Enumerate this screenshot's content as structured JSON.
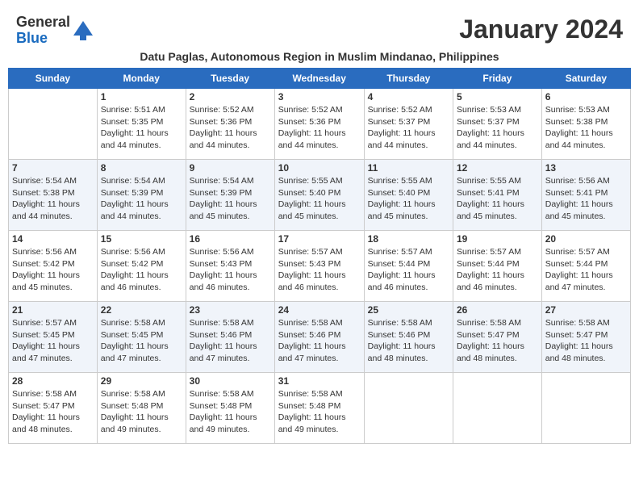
{
  "logo": {
    "text_general": "General",
    "text_blue": "Blue"
  },
  "header": {
    "month_year": "January 2024",
    "location": "Datu Paglas, Autonomous Region in Muslim Mindanao, Philippines"
  },
  "columns": [
    "Sunday",
    "Monday",
    "Tuesday",
    "Wednesday",
    "Thursday",
    "Friday",
    "Saturday"
  ],
  "weeks": [
    {
      "days": [
        {
          "number": "",
          "detail": ""
        },
        {
          "number": "1",
          "detail": "Sunrise: 5:51 AM\nSunset: 5:35 PM\nDaylight: 11 hours\nand 44 minutes."
        },
        {
          "number": "2",
          "detail": "Sunrise: 5:52 AM\nSunset: 5:36 PM\nDaylight: 11 hours\nand 44 minutes."
        },
        {
          "number": "3",
          "detail": "Sunrise: 5:52 AM\nSunset: 5:36 PM\nDaylight: 11 hours\nand 44 minutes."
        },
        {
          "number": "4",
          "detail": "Sunrise: 5:52 AM\nSunset: 5:37 PM\nDaylight: 11 hours\nand 44 minutes."
        },
        {
          "number": "5",
          "detail": "Sunrise: 5:53 AM\nSunset: 5:37 PM\nDaylight: 11 hours\nand 44 minutes."
        },
        {
          "number": "6",
          "detail": "Sunrise: 5:53 AM\nSunset: 5:38 PM\nDaylight: 11 hours\nand 44 minutes."
        }
      ]
    },
    {
      "days": [
        {
          "number": "7",
          "detail": "Sunrise: 5:54 AM\nSunset: 5:38 PM\nDaylight: 11 hours\nand 44 minutes."
        },
        {
          "number": "8",
          "detail": "Sunrise: 5:54 AM\nSunset: 5:39 PM\nDaylight: 11 hours\nand 44 minutes."
        },
        {
          "number": "9",
          "detail": "Sunrise: 5:54 AM\nSunset: 5:39 PM\nDaylight: 11 hours\nand 45 minutes."
        },
        {
          "number": "10",
          "detail": "Sunrise: 5:55 AM\nSunset: 5:40 PM\nDaylight: 11 hours\nand 45 minutes."
        },
        {
          "number": "11",
          "detail": "Sunrise: 5:55 AM\nSunset: 5:40 PM\nDaylight: 11 hours\nand 45 minutes."
        },
        {
          "number": "12",
          "detail": "Sunrise: 5:55 AM\nSunset: 5:41 PM\nDaylight: 11 hours\nand 45 minutes."
        },
        {
          "number": "13",
          "detail": "Sunrise: 5:56 AM\nSunset: 5:41 PM\nDaylight: 11 hours\nand 45 minutes."
        }
      ]
    },
    {
      "days": [
        {
          "number": "14",
          "detail": "Sunrise: 5:56 AM\nSunset: 5:42 PM\nDaylight: 11 hours\nand 45 minutes."
        },
        {
          "number": "15",
          "detail": "Sunrise: 5:56 AM\nSunset: 5:42 PM\nDaylight: 11 hours\nand 46 minutes."
        },
        {
          "number": "16",
          "detail": "Sunrise: 5:56 AM\nSunset: 5:43 PM\nDaylight: 11 hours\nand 46 minutes."
        },
        {
          "number": "17",
          "detail": "Sunrise: 5:57 AM\nSunset: 5:43 PM\nDaylight: 11 hours\nand 46 minutes."
        },
        {
          "number": "18",
          "detail": "Sunrise: 5:57 AM\nSunset: 5:44 PM\nDaylight: 11 hours\nand 46 minutes."
        },
        {
          "number": "19",
          "detail": "Sunrise: 5:57 AM\nSunset: 5:44 PM\nDaylight: 11 hours\nand 46 minutes."
        },
        {
          "number": "20",
          "detail": "Sunrise: 5:57 AM\nSunset: 5:44 PM\nDaylight: 11 hours\nand 47 minutes."
        }
      ]
    },
    {
      "days": [
        {
          "number": "21",
          "detail": "Sunrise: 5:57 AM\nSunset: 5:45 PM\nDaylight: 11 hours\nand 47 minutes."
        },
        {
          "number": "22",
          "detail": "Sunrise: 5:58 AM\nSunset: 5:45 PM\nDaylight: 11 hours\nand 47 minutes."
        },
        {
          "number": "23",
          "detail": "Sunrise: 5:58 AM\nSunset: 5:46 PM\nDaylight: 11 hours\nand 47 minutes."
        },
        {
          "number": "24",
          "detail": "Sunrise: 5:58 AM\nSunset: 5:46 PM\nDaylight: 11 hours\nand 47 minutes."
        },
        {
          "number": "25",
          "detail": "Sunrise: 5:58 AM\nSunset: 5:46 PM\nDaylight: 11 hours\nand 48 minutes."
        },
        {
          "number": "26",
          "detail": "Sunrise: 5:58 AM\nSunset: 5:47 PM\nDaylight: 11 hours\nand 48 minutes."
        },
        {
          "number": "27",
          "detail": "Sunrise: 5:58 AM\nSunset: 5:47 PM\nDaylight: 11 hours\nand 48 minutes."
        }
      ]
    },
    {
      "days": [
        {
          "number": "28",
          "detail": "Sunrise: 5:58 AM\nSunset: 5:47 PM\nDaylight: 11 hours\nand 48 minutes."
        },
        {
          "number": "29",
          "detail": "Sunrise: 5:58 AM\nSunset: 5:48 PM\nDaylight: 11 hours\nand 49 minutes."
        },
        {
          "number": "30",
          "detail": "Sunrise: 5:58 AM\nSunset: 5:48 PM\nDaylight: 11 hours\nand 49 minutes."
        },
        {
          "number": "31",
          "detail": "Sunrise: 5:58 AM\nSunset: 5:48 PM\nDaylight: 11 hours\nand 49 minutes."
        },
        {
          "number": "",
          "detail": ""
        },
        {
          "number": "",
          "detail": ""
        },
        {
          "number": "",
          "detail": ""
        }
      ]
    }
  ]
}
